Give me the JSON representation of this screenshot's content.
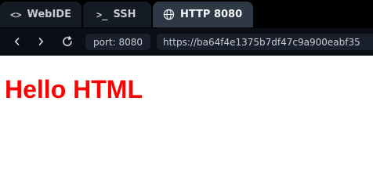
{
  "tabs": [
    {
      "label": "WebIDE",
      "icon": "code-brackets-icon",
      "active": false
    },
    {
      "label": "SSH",
      "icon": "terminal-prompt-icon",
      "active": false
    },
    {
      "label": "HTTP 8080",
      "icon": "globe-icon",
      "active": true
    }
  ],
  "navigation": {
    "back_icon": "chevron-left-icon",
    "forward_icon": "chevron-right-icon",
    "reload_icon": "reload-icon",
    "port_label": "port: 8080",
    "url": "https://ba64f4e1375b7df47c9a900eabf35"
  },
  "page": {
    "heading": "Hello HTML"
  },
  "colors": {
    "heading": "#ff0000",
    "tabbar_background": "#000000",
    "navbar_background": "#0b0f15",
    "active_tab": "#2f3845"
  }
}
